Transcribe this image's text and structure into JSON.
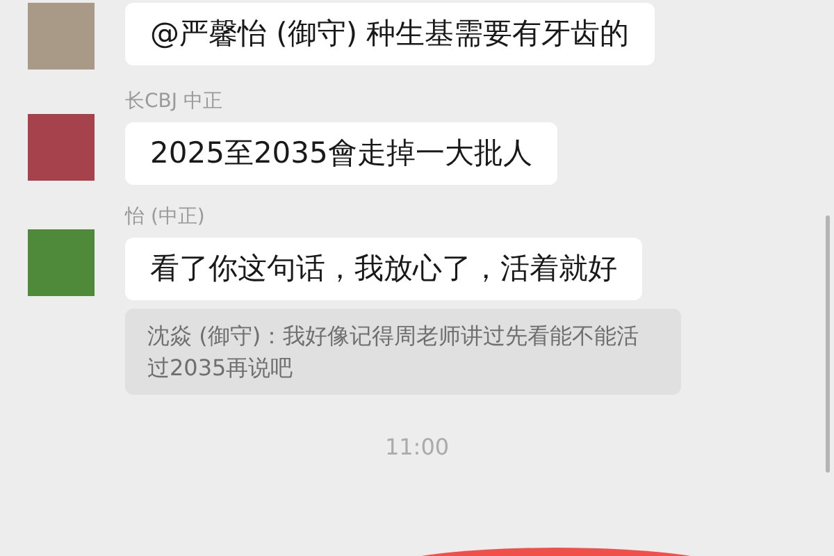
{
  "messages": [
    {
      "text": "@严馨怡 (御守) 种生基需要有牙齿的"
    },
    {
      "sender": "长CBJ  中正",
      "text": "2025至2035會走掉一大批人"
    },
    {
      "sender": "怡 (中正)",
      "text": "看了你这句话，我放心了，活着就好",
      "quote": "沈焱 (御守)：我好像记得周老师讲过先看能不能活过2035再说吧"
    }
  ],
  "timestamp": "11:00"
}
